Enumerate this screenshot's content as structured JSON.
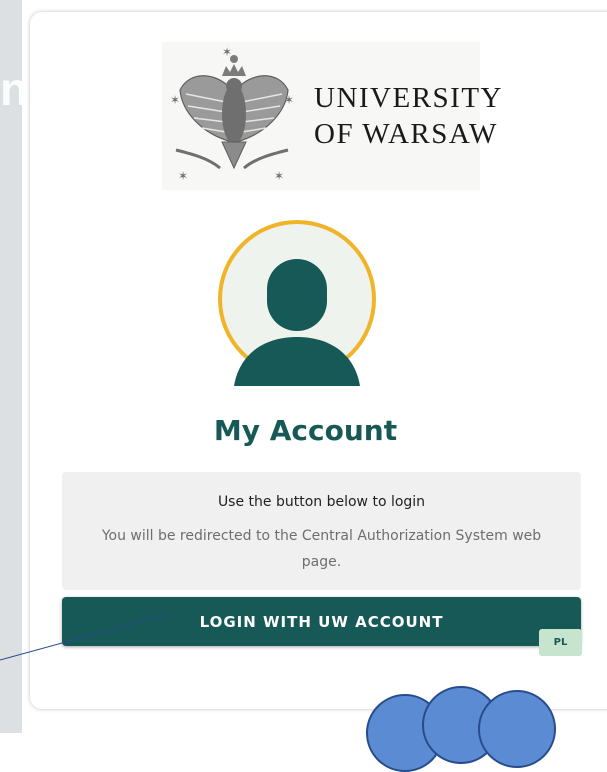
{
  "logo": {
    "line1": "UNIVERSITY",
    "line2": "OF WARSAW",
    "overlay_text": "nive"
  },
  "account": {
    "title": "My Account"
  },
  "info": {
    "title": "Use the button below to login",
    "detail": "You will be redirected to the Central Authorization System web page."
  },
  "buttons": {
    "login": "LOGIN WITH UW ACCOUNT",
    "language": "PL"
  },
  "colors": {
    "primary": "#175957",
    "avatar_ring": "#f0b429",
    "avatar_bg": "#eef3ee",
    "language_bg": "#c7e4cf"
  },
  "icons": {
    "avatar": "user-silhouette-icon",
    "emblem": "eagle-emblem"
  }
}
